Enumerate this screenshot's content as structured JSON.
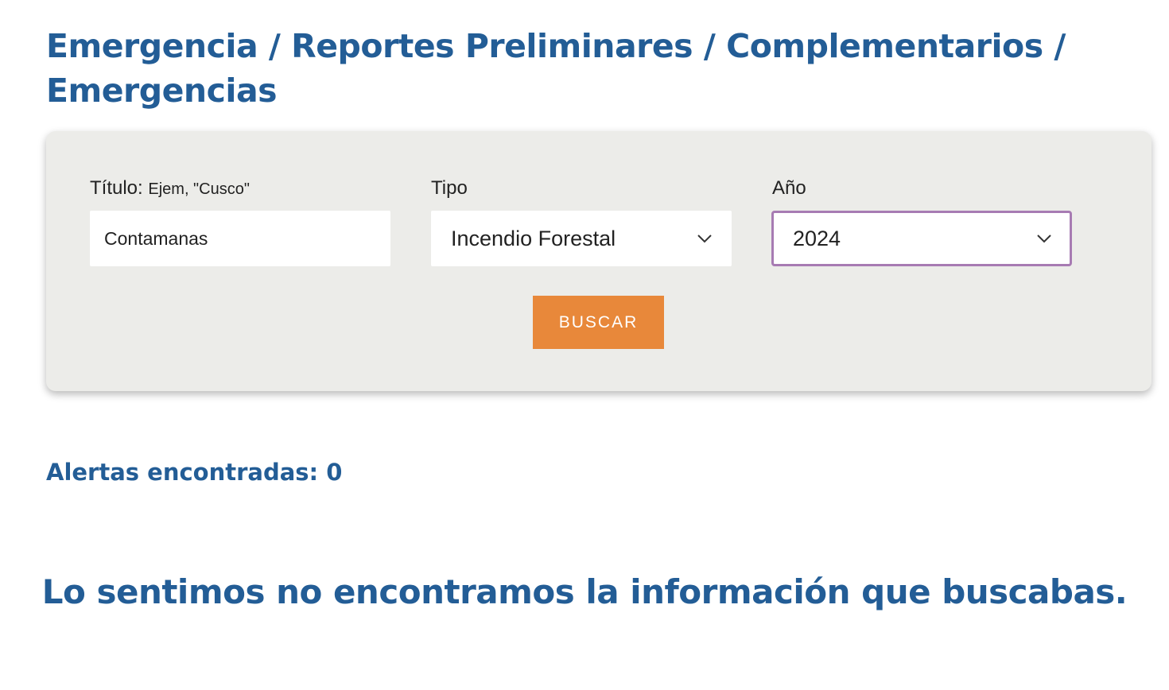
{
  "header": {
    "breadcrumb_title": "Emergencia / Reportes Preliminares / Complementarios / Emergencias"
  },
  "search": {
    "title_label": "Título:",
    "title_hint": "Ejem, \"Cusco\"",
    "title_value": "Contamanas",
    "type_label": "Tipo",
    "type_selected": "Incendio Forestal",
    "year_label": "Año",
    "year_selected": "2024",
    "search_button_label": "BUSCAR"
  },
  "results": {
    "count_label": "Alertas encontradas:",
    "count_value": "0",
    "empty_message": "Lo sentimos no encontramos la información que buscabas."
  },
  "colors": {
    "brand_blue": "#235d96",
    "button_orange": "#e8883a",
    "panel_background": "#ecece9",
    "focus_border": "#a77bb3"
  },
  "icons": {
    "type_select_arrow": "chevron-down-icon",
    "year_select_arrow": "chevron-down-icon"
  }
}
